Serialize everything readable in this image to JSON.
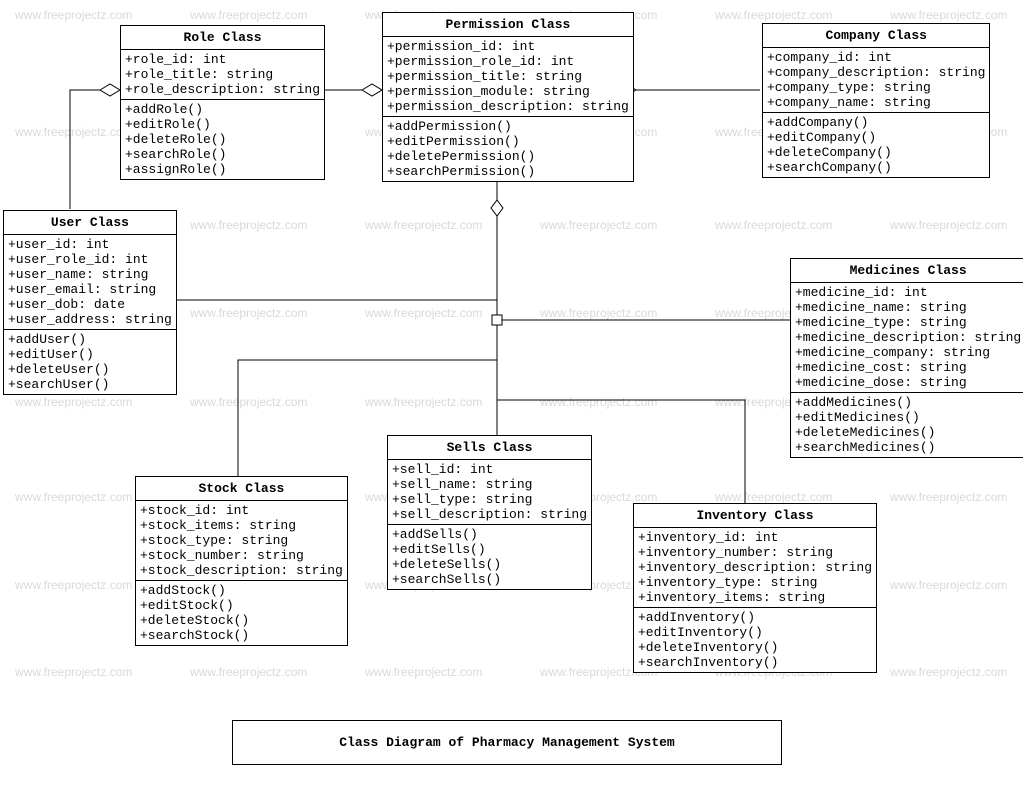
{
  "title": "Class Diagram of Pharmacy Management System",
  "watermark_text": "www.freeprojectz.com",
  "classes": {
    "role": {
      "name": "Role Class",
      "attrs": [
        "+role_id: int",
        "+role_title: string",
        "+role_description: string"
      ],
      "methods": [
        "+addRole()",
        "+editRole()",
        "+deleteRole()",
        "+searchRole()",
        "+assignRole()"
      ]
    },
    "permission": {
      "name": "Permission Class",
      "attrs": [
        "+permission_id: int",
        "+permission_role_id: int",
        "+permission_title: string",
        "+permission_module: string",
        "+permission_description: string"
      ],
      "methods": [
        "+addPermission()",
        "+editPermission()",
        "+deletePermission()",
        "+searchPermission()"
      ]
    },
    "company": {
      "name": "Company Class",
      "attrs": [
        "+company_id: int",
        "+company_description: string",
        "+company_type: string",
        "+company_name: string"
      ],
      "methods": [
        "+addCompany()",
        "+editCompany()",
        "+deleteCompany()",
        "+searchCompany()"
      ]
    },
    "user": {
      "name": "User Class",
      "attrs": [
        "+user_id: int",
        "+user_role_id: int",
        "+user_name: string",
        "+user_email: string",
        "+user_dob: date",
        "+user_address: string"
      ],
      "methods": [
        "+addUser()",
        "+editUser()",
        "+deleteUser()",
        "+searchUser()"
      ]
    },
    "medicines": {
      "name": "Medicines Class",
      "attrs": [
        "+medicine_id: int",
        "+medicine_name: string",
        "+medicine_type: string",
        "+medicine_description: string",
        "+medicine_company: string",
        "+medicine_cost: string",
        "+medicine_dose: string"
      ],
      "methods": [
        "+addMedicines()",
        "+editMedicines()",
        "+deleteMedicines()",
        "+searchMedicines()"
      ]
    },
    "sells": {
      "name": "Sells Class",
      "attrs": [
        "+sell_id: int",
        "+sell_name: string",
        "+sell_type: string",
        "+sell_description: string"
      ],
      "methods": [
        "+addSells()",
        "+editSells()",
        "+deleteSells()",
        "+searchSells()"
      ]
    },
    "stock": {
      "name": "Stock Class",
      "attrs": [
        "+stock_id: int",
        "+stock_items: string",
        "+stock_type: string",
        "+stock_number: string",
        "+stock_description: string"
      ],
      "methods": [
        "+addStock()",
        "+editStock()",
        "+deleteStock()",
        "+searchStock()"
      ]
    },
    "inventory": {
      "name": "Inventory Class",
      "attrs": [
        "+inventory_id: int",
        "+inventory_number: string",
        "+inventory_description: string",
        "+inventory_type: string",
        "+inventory_items: string"
      ],
      "methods": [
        "+addInventory()",
        "+editInventory()",
        "+deleteInventory()",
        "+searchInventory()"
      ]
    }
  }
}
